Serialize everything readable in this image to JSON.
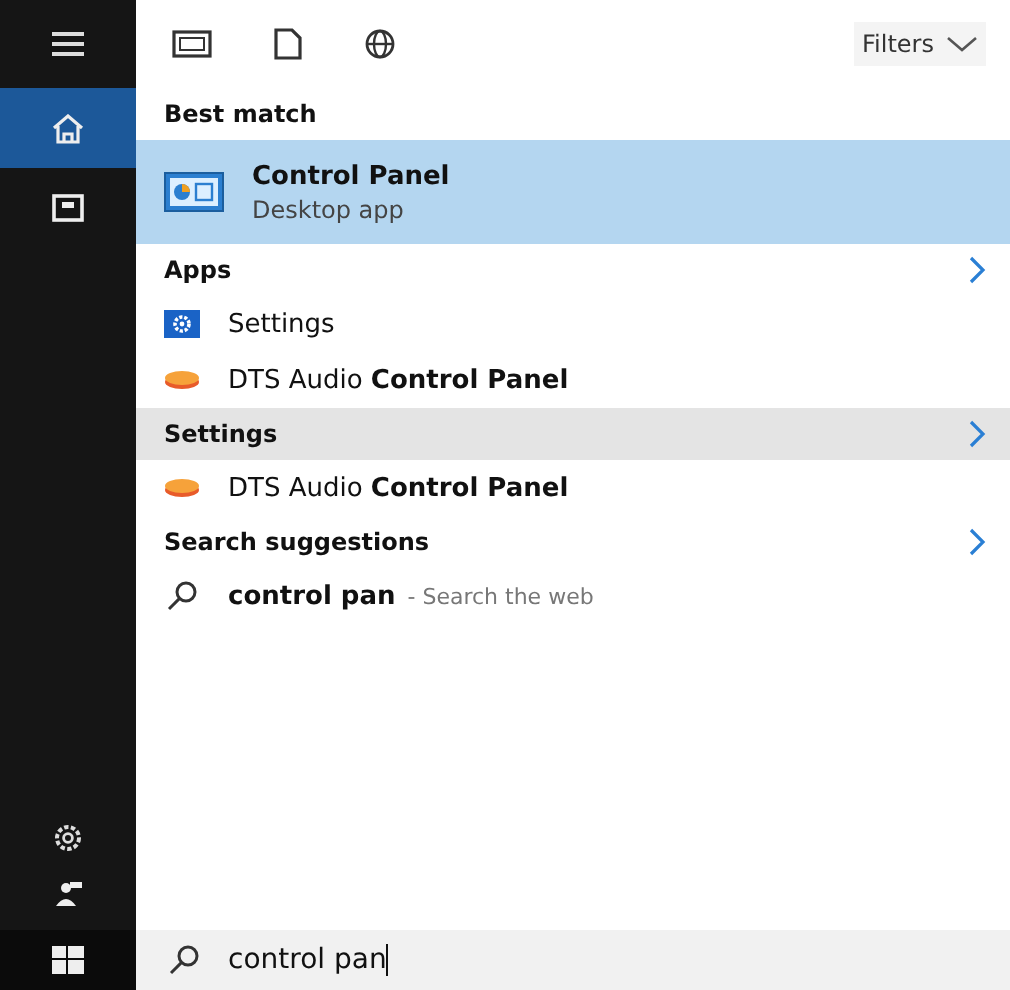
{
  "sidebar": {
    "nav": [
      {
        "selected": true
      },
      {
        "selected": false
      }
    ]
  },
  "toolbar": {
    "filters": "Filters"
  },
  "sections": [
    {
      "header": "Best match",
      "highlighted": false,
      "more": false,
      "items": [
        {
          "kind": "app",
          "title": "Control Panel",
          "subtitle": "Desktop app",
          "selected": true
        }
      ]
    },
    {
      "header": "Apps",
      "highlighted": false,
      "more": true,
      "items": [
        {
          "kind": "settings",
          "title": "Settings",
          "selected": false
        },
        {
          "kind": "dts",
          "title": "DTS Audio **Control Panel**",
          "selected": false
        }
      ]
    },
    {
      "header": "Settings",
      "highlighted": true,
      "more": true,
      "items": [
        {
          "kind": "dts",
          "title": "DTS Audio **Control Panel**",
          "selected": false
        }
      ]
    },
    {
      "header": "Search suggestions",
      "highlighted": false,
      "more": true,
      "items": [
        {
          "kind": "web",
          "title": "control pan",
          "subtitle": "- Search the web",
          "selected": false
        }
      ]
    }
  ],
  "search": {
    "value": "control pan"
  }
}
